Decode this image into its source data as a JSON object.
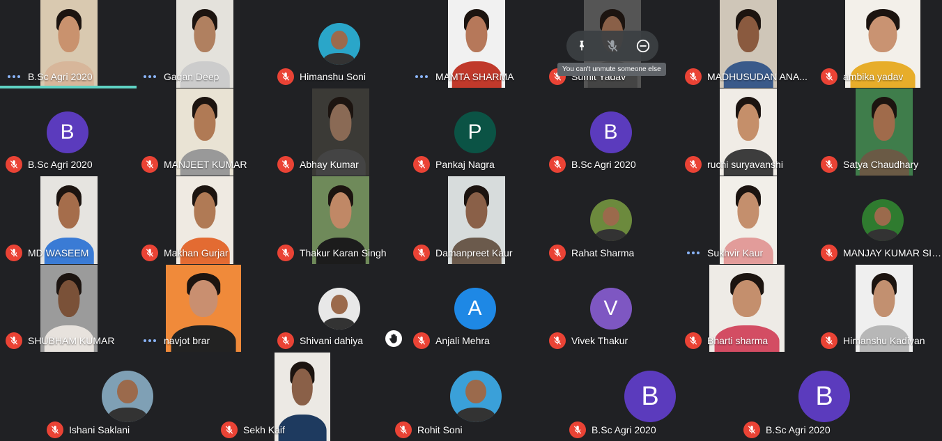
{
  "colors": {
    "background": "#202124",
    "muted_mic": "#ea4335",
    "speaking_indicator": "#5fd3c4",
    "speaking_dots": "#8ab4f8"
  },
  "participants": [
    {
      "name": "B.Sc Agri 2020",
      "mic": "speaking",
      "tile": "video"
    },
    {
      "name": "Gagan Deep",
      "mic": "speaking",
      "tile": "video"
    },
    {
      "name": "Himanshu Soni",
      "mic": "muted",
      "tile": "photo"
    },
    {
      "name": "MAMTA SHARMA",
      "mic": "speaking",
      "tile": "video"
    },
    {
      "name": "Sumit Yadav",
      "mic": "muted",
      "tile": "video"
    },
    {
      "name": "MADHUSUDAN ANA...",
      "mic": "muted",
      "tile": "video"
    },
    {
      "name": "ambika yadav",
      "mic": "muted",
      "tile": "video"
    },
    {
      "name": "B.Sc Agri 2020",
      "mic": "muted",
      "tile": "letter",
      "letter": "B",
      "avatar_color": "#5b3bbd"
    },
    {
      "name": "MANJEET KUMAR",
      "mic": "muted",
      "tile": "video"
    },
    {
      "name": "Abhay Kumar",
      "mic": "muted",
      "tile": "video"
    },
    {
      "name": "Pankaj Nagra",
      "mic": "muted",
      "tile": "letter",
      "letter": "P",
      "avatar_color": "#0b5345"
    },
    {
      "name": "B.Sc Agri 2020",
      "mic": "muted",
      "tile": "letter",
      "letter": "B",
      "avatar_color": "#5b3bbd"
    },
    {
      "name": "ruchi suryavanshi",
      "mic": "muted",
      "tile": "video"
    },
    {
      "name": "Satya Chaudhary",
      "mic": "muted",
      "tile": "video"
    },
    {
      "name": "MD WASEEM",
      "mic": "muted",
      "tile": "video"
    },
    {
      "name": "Makhan Gurjar",
      "mic": "muted",
      "tile": "video"
    },
    {
      "name": "Thakur Karan Singh",
      "mic": "muted",
      "tile": "video"
    },
    {
      "name": "Damanpreet Kaur",
      "mic": "muted",
      "tile": "video"
    },
    {
      "name": "Rahat Sharma",
      "mic": "muted",
      "tile": "photo"
    },
    {
      "name": "Sukhvir Kaur",
      "mic": "speaking",
      "tile": "video"
    },
    {
      "name": "MANJAY KUMAR SIN...",
      "mic": "muted",
      "tile": "photo"
    },
    {
      "name": "SHUBHAM KUMAR",
      "mic": "muted",
      "tile": "video"
    },
    {
      "name": "navjot brar",
      "mic": "speaking",
      "tile": "video"
    },
    {
      "name": "Shivani dahiya",
      "mic": "muted",
      "tile": "photo",
      "hand_raised": true
    },
    {
      "name": "Anjali Mehra",
      "mic": "muted",
      "tile": "letter",
      "letter": "A",
      "avatar_color": "#1e88e5"
    },
    {
      "name": "Vivek Thakur",
      "mic": "muted",
      "tile": "letter",
      "letter": "V",
      "avatar_color": "#7e57c2"
    },
    {
      "name": "Bharti sharma",
      "mic": "muted",
      "tile": "video"
    },
    {
      "name": "Himanshu Kadiyan",
      "mic": "muted",
      "tile": "video"
    },
    {
      "name": "Ishani Saklani",
      "mic": "muted",
      "tile": "photo"
    },
    {
      "name": "Sekh Kaif",
      "mic": "muted",
      "tile": "video"
    },
    {
      "name": "Rohit Soni",
      "mic": "muted",
      "tile": "photo"
    },
    {
      "name": "B.Sc Agri 2020",
      "mic": "muted",
      "tile": "letter",
      "letter": "B",
      "avatar_color": "#5b3bbd"
    },
    {
      "name": "B.Sc Agri 2020",
      "mic": "muted",
      "tile": "letter",
      "letter": "B",
      "avatar_color": "#5b3bbd"
    }
  ],
  "hover_controls": {
    "tooltip": "You can't unmute someone else",
    "icons": [
      "pin-icon",
      "mic-off-icon",
      "remove-icon"
    ]
  }
}
